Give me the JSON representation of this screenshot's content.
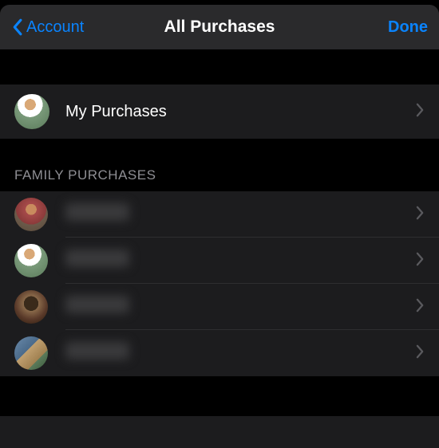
{
  "nav": {
    "back_label": "Account",
    "title": "All Purchases",
    "done_label": "Done"
  },
  "my_purchases": {
    "label": "My Purchases"
  },
  "section_header": "Family Purchases",
  "family": [
    {
      "name": ""
    },
    {
      "name": ""
    },
    {
      "name": ""
    },
    {
      "name": ""
    }
  ]
}
